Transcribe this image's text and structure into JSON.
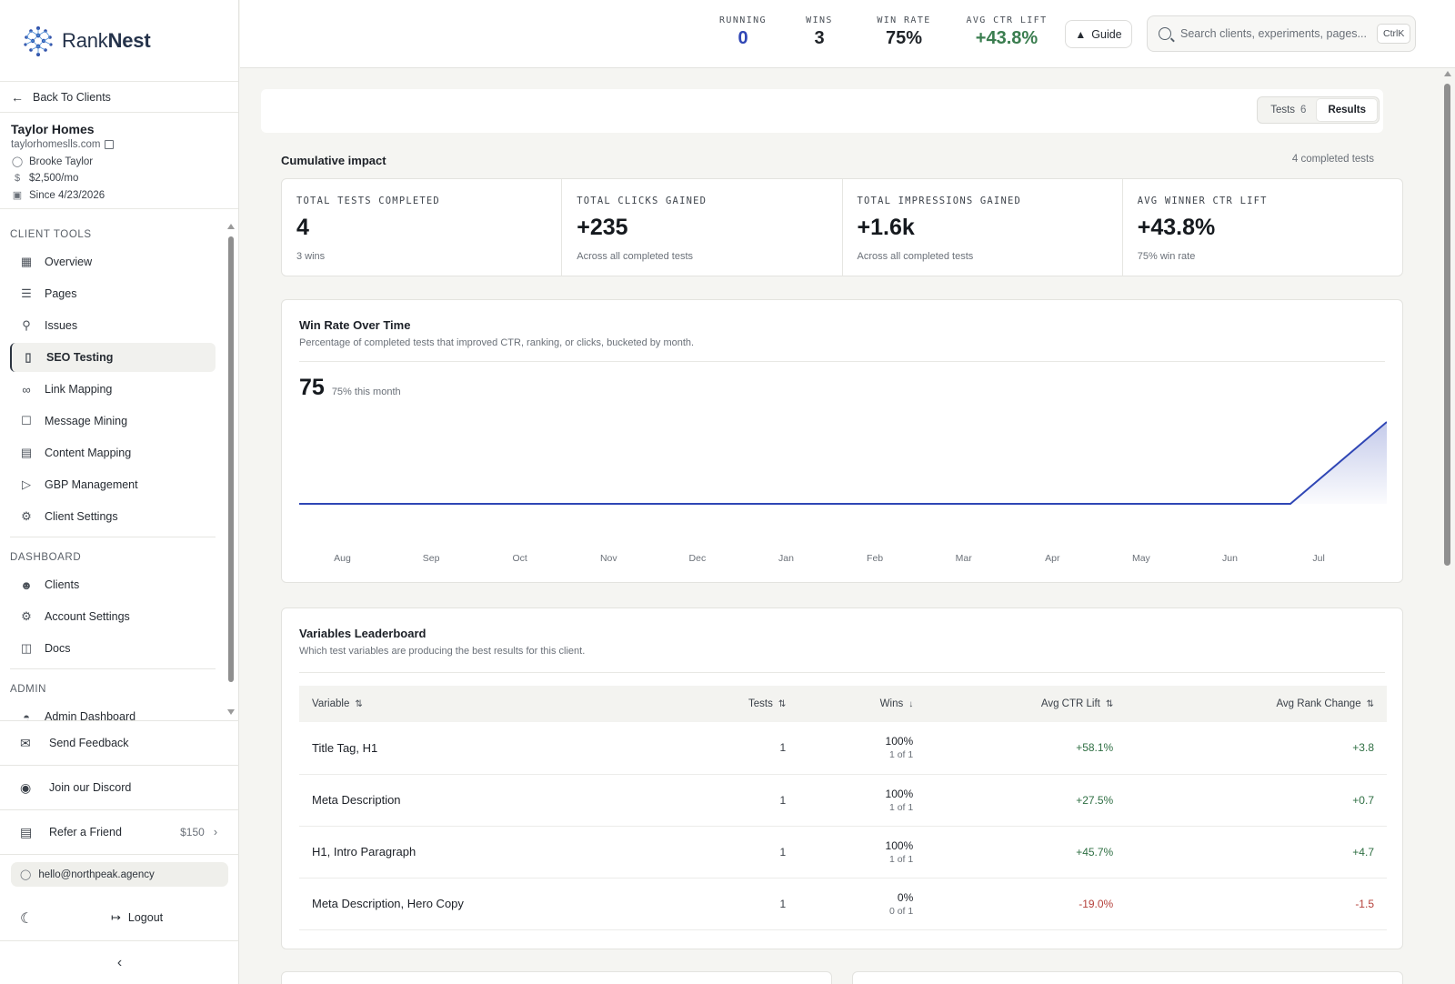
{
  "brand": {
    "name_light": "Rank",
    "name_bold": "Nest"
  },
  "sidebar": {
    "back_label": "Back To Clients",
    "client": {
      "name": "Taylor Homes",
      "url": "taylorhomeslls.com",
      "owner": "Brooke Taylor",
      "price": "$2,500/mo",
      "since": "Since 4/23/2026"
    },
    "sections": {
      "client_tools": "CLIENT TOOLS",
      "dashboard": "DASHBOARD",
      "admin": "ADMIN",
      "admin_partial": "Admin Dashboard"
    },
    "client_tools": [
      {
        "label": "Overview",
        "icon": "grid-icon"
      },
      {
        "label": "Pages",
        "icon": "layers-icon"
      },
      {
        "label": "Issues",
        "icon": "magnifier-icon"
      },
      {
        "label": "SEO Testing",
        "icon": "test-tube-icon"
      },
      {
        "label": "Link Mapping",
        "icon": "link-icon"
      },
      {
        "label": "Message Mining",
        "icon": "chat-icon"
      },
      {
        "label": "Content Mapping",
        "icon": "document-icon"
      },
      {
        "label": "GBP Management",
        "icon": "megaphone-icon"
      },
      {
        "label": "Client Settings",
        "icon": "gear-icon"
      }
    ],
    "dashboard": [
      {
        "label": "Clients",
        "icon": "users-icon"
      },
      {
        "label": "Account Settings",
        "icon": "gear-icon"
      },
      {
        "label": "Docs",
        "icon": "book-icon"
      }
    ],
    "footer": {
      "feedback": "Send Feedback",
      "discord": "Join our Discord",
      "refer": "Refer a Friend",
      "refer_amount": "$150",
      "email": "hello@northpeak.agency",
      "logout": "Logout"
    }
  },
  "header": {
    "stats": [
      {
        "label": "RUNNING",
        "value": "0",
        "color": "#2f46b5"
      },
      {
        "label": "WINS",
        "value": "3",
        "color": "#15191e"
      },
      {
        "label": "WIN RATE",
        "value": "75%",
        "color": "#15191e"
      },
      {
        "label": "AVG CTR LIFT",
        "value": "+43.8%",
        "color": "#3a7d4f"
      }
    ],
    "guide_label": "Guide",
    "search_placeholder": "Search clients, experiments, pages...",
    "search_kbd": "CtrlK"
  },
  "tabs": {
    "tests_label": "Tests",
    "tests_count": "6",
    "results_label": "Results"
  },
  "cumulative": {
    "title": "Cumulative impact",
    "note": "4 completed tests",
    "kpis": [
      {
        "label": "TOTAL TESTS COMPLETED",
        "value": "4",
        "sub": "3 wins"
      },
      {
        "label": "TOTAL CLICKS GAINED",
        "value": "+235",
        "sub": "Across all completed tests"
      },
      {
        "label": "TOTAL IMPRESSIONS GAINED",
        "value": "+1.6k",
        "sub": "Across all completed tests"
      },
      {
        "label": "AVG WINNER CTR LIFT",
        "value": "+43.8%",
        "sub": "75% win rate"
      }
    ]
  },
  "winrate": {
    "title": "Win Rate Over Time",
    "subtitle": "Percentage of completed tests that improved CTR, ranking, or clicks, bucketed by month.",
    "current": "75",
    "current_sub": "75% this month"
  },
  "chart_data": {
    "type": "area",
    "categories": [
      "Aug",
      "Sep",
      "Oct",
      "Nov",
      "Dec",
      "Jan",
      "Feb",
      "Mar",
      "Apr",
      "May",
      "Jun",
      "Jul"
    ],
    "values": [
      0,
      0,
      0,
      0,
      0,
      0,
      0,
      0,
      0,
      0,
      0,
      75
    ],
    "ylim": [
      0,
      75
    ],
    "line_color": "#2f46b5",
    "grid": false
  },
  "leaderboard": {
    "title": "Variables Leaderboard",
    "subtitle": "Which test variables are producing the best results for this client.",
    "columns": [
      "Variable",
      "Tests",
      "Wins",
      "Avg CTR Lift",
      "Avg Rank Change"
    ],
    "rows": [
      {
        "variable": "Title Tag, H1",
        "tests": "1",
        "win_pct": "100%",
        "win_frac": "1 of 1",
        "ctr": "+58.1%",
        "rank": "+3.8",
        "positive": true
      },
      {
        "variable": "Meta Description",
        "tests": "1",
        "win_pct": "100%",
        "win_frac": "1 of 1",
        "ctr": "+27.5%",
        "rank": "+0.7",
        "positive": true
      },
      {
        "variable": "H1, Intro Paragraph",
        "tests": "1",
        "win_pct": "100%",
        "win_frac": "1 of 1",
        "ctr": "+45.7%",
        "rank": "+4.7",
        "positive": true
      },
      {
        "variable": "Meta Description, Hero Copy",
        "tests": "1",
        "win_pct": "0%",
        "win_frac": "0 of 1",
        "ctr": "-19.0%",
        "rank": "-1.5",
        "positive": false
      }
    ]
  }
}
